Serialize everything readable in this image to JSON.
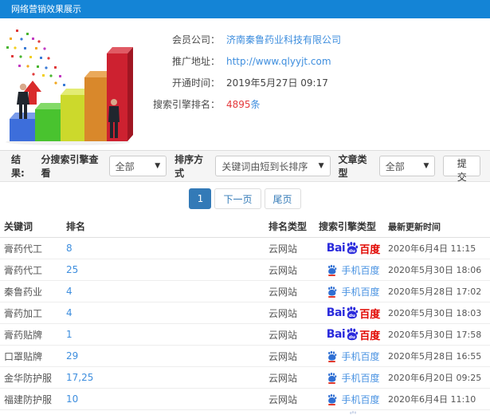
{
  "header": {
    "title": "网络营销效果展示"
  },
  "colors": {
    "header_bg": "#1484d6",
    "link_blue": "#3e8ede",
    "highlight_red": "#e4393c",
    "active_page": "#337ab7",
    "baidu_blue": "#2b2bdc",
    "baidu_red": "#e10600"
  },
  "info": {
    "fields": [
      {
        "label": "会员公司：",
        "value": "济南秦鲁药业科技有限公司"
      },
      {
        "label": "推广地址：",
        "value": "http://www.qlyyjt.com"
      },
      {
        "label": "开通时间：",
        "value": "2019年5月27日 09:17"
      },
      {
        "label": "搜索引擎排名：",
        "value": "4895",
        "suffix": "条"
      }
    ]
  },
  "filters": {
    "section_label": "结果:",
    "engine_label": "分搜索引擎查看",
    "engine_value": "全部",
    "sort_label": "排序方式",
    "sort_value": "关键词由短到长排序",
    "article_label": "文章类型",
    "article_value": "全部",
    "submit_label": "提交"
  },
  "pagination": {
    "current": "1",
    "next_label": "下一页",
    "last_label": "尾页"
  },
  "engines": {
    "baidu_pc": {
      "bai": "Bai",
      "du": "du",
      "cn": "百度"
    },
    "baidu_mobile": {
      "label": "手机百度"
    }
  },
  "table": {
    "columns": [
      "关键词",
      "排名",
      "排名类型",
      "搜索引擎类型",
      "最新更新时间"
    ],
    "rows": [
      {
        "keyword": "膏药代工",
        "rank": "8",
        "rank_type": "云网站",
        "engine": "baidu-pc",
        "updated": "2020年6月4日 11:15"
      },
      {
        "keyword": "膏药代工",
        "rank": "25",
        "rank_type": "云网站",
        "engine": "baidu-mobile",
        "updated": "2020年5月30日 18:06"
      },
      {
        "keyword": "秦鲁药业",
        "rank": "4",
        "rank_type": "云网站",
        "engine": "baidu-mobile",
        "updated": "2020年5月28日 17:02"
      },
      {
        "keyword": "膏药加工",
        "rank": "4",
        "rank_type": "云网站",
        "engine": "baidu-pc",
        "updated": "2020年5月30日 18:03"
      },
      {
        "keyword": "膏药贴牌",
        "rank": "1",
        "rank_type": "云网站",
        "engine": "baidu-pc",
        "updated": "2020年5月30日 17:58"
      },
      {
        "keyword": "口罩贴牌",
        "rank": "29",
        "rank_type": "云网站",
        "engine": "baidu-mobile",
        "updated": "2020年5月28日 16:55"
      },
      {
        "keyword": "金华防护服",
        "rank": "17,25",
        "rank_type": "云网站",
        "engine": "baidu-mobile",
        "updated": "2020年6月20日 09:25"
      },
      {
        "keyword": "福建防护服",
        "rank": "10",
        "rank_type": "云网站",
        "engine": "baidu-mobile",
        "updated": "2020年6月4日 11:10"
      }
    ]
  }
}
